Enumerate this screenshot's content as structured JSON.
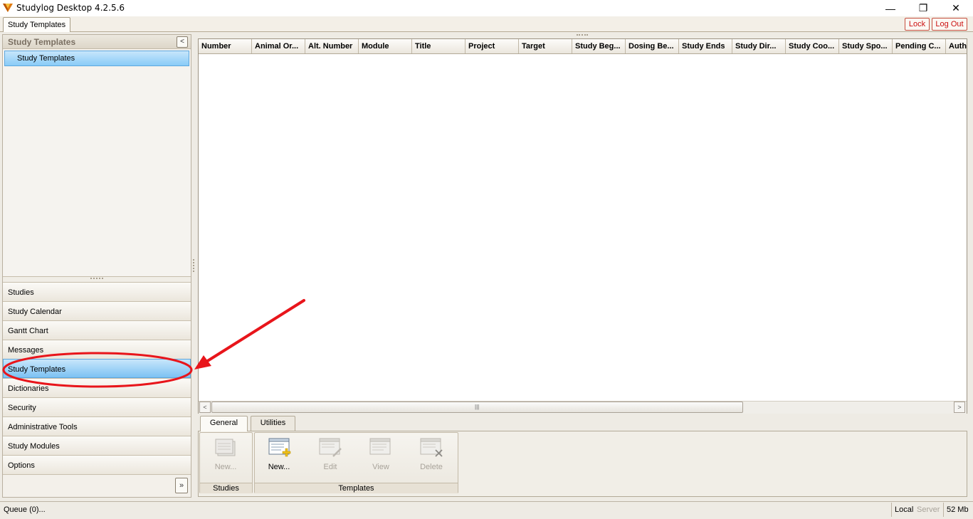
{
  "window": {
    "title": "Studylog Desktop 4.2.5.6",
    "minimize_glyph": "—",
    "maximize_glyph": "❐",
    "close_glyph": "✕"
  },
  "document_tab": {
    "label": "Study Templates"
  },
  "top_buttons": {
    "lock": "Lock",
    "logout": "Log Out"
  },
  "left_panel": {
    "header": "Study Templates",
    "collapse_glyph": "<",
    "tree_items": [
      "Study Templates"
    ],
    "nav_items": [
      "Studies",
      "Study Calendar",
      "Gantt Chart",
      "Messages",
      "Study Templates",
      "Dictionaries",
      "Security",
      "Administrative Tools",
      "Study Modules",
      "Options"
    ],
    "active_nav_index": 4,
    "expand_glyph": "»"
  },
  "grid": {
    "columns": [
      "Number",
      "Animal Or...",
      "Alt. Number",
      "Module",
      "Title",
      "Project",
      "Target",
      "Study Beg...",
      "Dosing Be...",
      "Study Ends",
      "Study Dir...",
      "Study Coo...",
      "Study Spo...",
      "Pending C...",
      "Auth"
    ],
    "scroll_left_glyph": "<",
    "scroll_right_glyph": ">",
    "scroll_thumb_glyph": "|||"
  },
  "ribbon": {
    "tabs": [
      "General",
      "Utilities"
    ],
    "active_tab": "General",
    "groups": {
      "studies": {
        "label": "Studies",
        "buttons": [
          {
            "label": "New...",
            "enabled": false
          }
        ]
      },
      "templates": {
        "label": "Templates",
        "buttons": [
          {
            "label": "New...",
            "enabled": true
          },
          {
            "label": "Edit",
            "enabled": false
          },
          {
            "label": "View",
            "enabled": false
          },
          {
            "label": "Delete",
            "enabled": false
          }
        ]
      }
    }
  },
  "status_bar": {
    "queue": "Queue (0)...",
    "local": "Local",
    "server": "Server",
    "memory": "52 Mb"
  },
  "colors": {
    "annotation": "#e8151b",
    "selection_top": "#c7e6fb",
    "selection_bottom": "#7cc2f3",
    "accent_text": "#cc1010"
  },
  "icons": {
    "app": "studylog-logo-icon",
    "new_study": "new-study-icon",
    "new_template": "new-template-icon",
    "edit_template": "edit-template-icon",
    "view_template": "view-template-icon",
    "delete_template": "delete-template-icon"
  }
}
